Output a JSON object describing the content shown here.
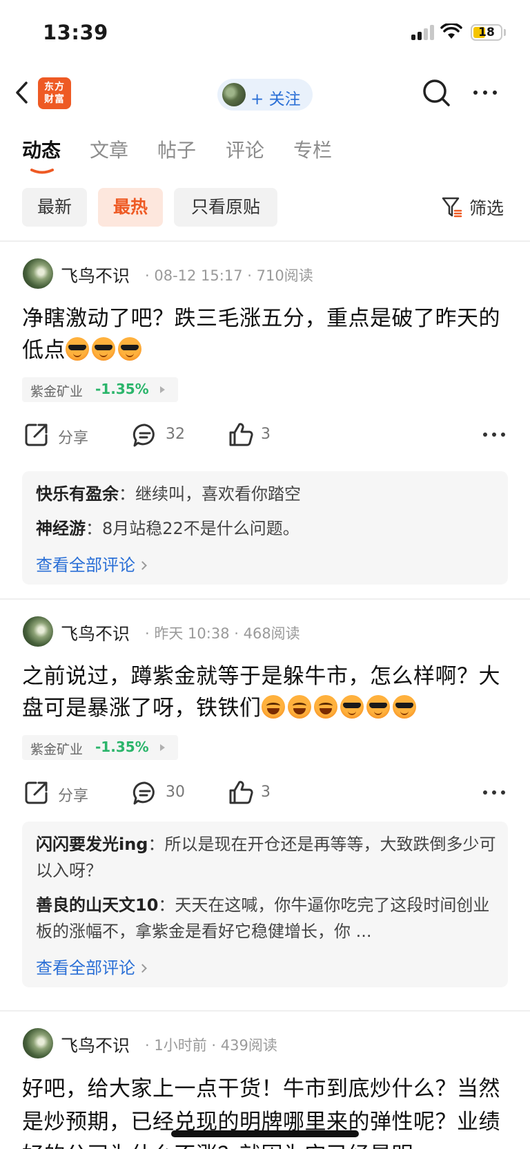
{
  "status_bar": {
    "time": "13:39",
    "battery": "18"
  },
  "nav": {
    "logo_line1": "东方",
    "logo_line2": "财富",
    "follow_label": "+ 关注"
  },
  "tabs": [
    {
      "label": "动态",
      "active": true
    },
    {
      "label": "文章"
    },
    {
      "label": "帖子"
    },
    {
      "label": "评论"
    },
    {
      "label": "专栏"
    }
  ],
  "filters": [
    {
      "label": "最新"
    },
    {
      "label": "最热",
      "active": true
    },
    {
      "label": "只看原贴"
    }
  ],
  "filter_button": "筛选",
  "colors": {
    "accent": "#ee5a24",
    "link": "#2a6fd6",
    "stock_down": "#2bb56b"
  },
  "posts": [
    {
      "author": "飞鸟不识",
      "time": "08-12 15:17",
      "reads": "710阅读",
      "text": "净瞎激动了吧？跌三毛涨五分，重点是破了昨天的低点",
      "emojis": [
        "cool-emoji",
        "cool-emoji",
        "cool-emoji"
      ],
      "stock": {
        "name": "紫金矿业",
        "change": "-1.35%"
      },
      "share_label": "分享",
      "comment_count": "32",
      "like_count": "3",
      "comments": [
        {
          "user": "快乐有盈余",
          "text": "继续叫，喜欢看你踏空"
        },
        {
          "user": "神经游",
          "text": "8月站稳22不是什么问题。"
        }
      ],
      "view_all": "查看全部评论"
    },
    {
      "author": "飞鸟不识",
      "time": "昨天 10:38",
      "reads": "468阅读",
      "text": "之前说过，蹲紫金就等于是躲牛市，怎么样啊？大盘可是暴涨了呀，铁铁们",
      "emojis": [
        "laugh-emoji",
        "laugh-emoji",
        "laugh-emoji",
        "cool-emoji",
        "cool-emoji",
        "cool-emoji"
      ],
      "stock": {
        "name": "紫金矿业",
        "change": "-1.35%"
      },
      "share_label": "分享",
      "comment_count": "30",
      "like_count": "3",
      "comments": [
        {
          "user": "闪闪要发光ing",
          "text": "所以是现在开仓还是再等等，大致跌倒多少可以入呀？"
        },
        {
          "user": "善良的山天文10",
          "text": "天天在这喊，你牛逼你吃完了这段时间创业板的涨幅不，拿紫金是看好它稳健增长，你 ..."
        }
      ],
      "view_all": "查看全部评论"
    },
    {
      "author": "飞鸟不识",
      "time": "1小时前",
      "reads": "439阅读",
      "text": "好吧，给大家上一点干货！牛市到底炒什么？当然是炒预期，已经兑现的明牌哪里来的弹性呢？业绩好的公司为什么不涨？就因为它已经是明"
    }
  ]
}
